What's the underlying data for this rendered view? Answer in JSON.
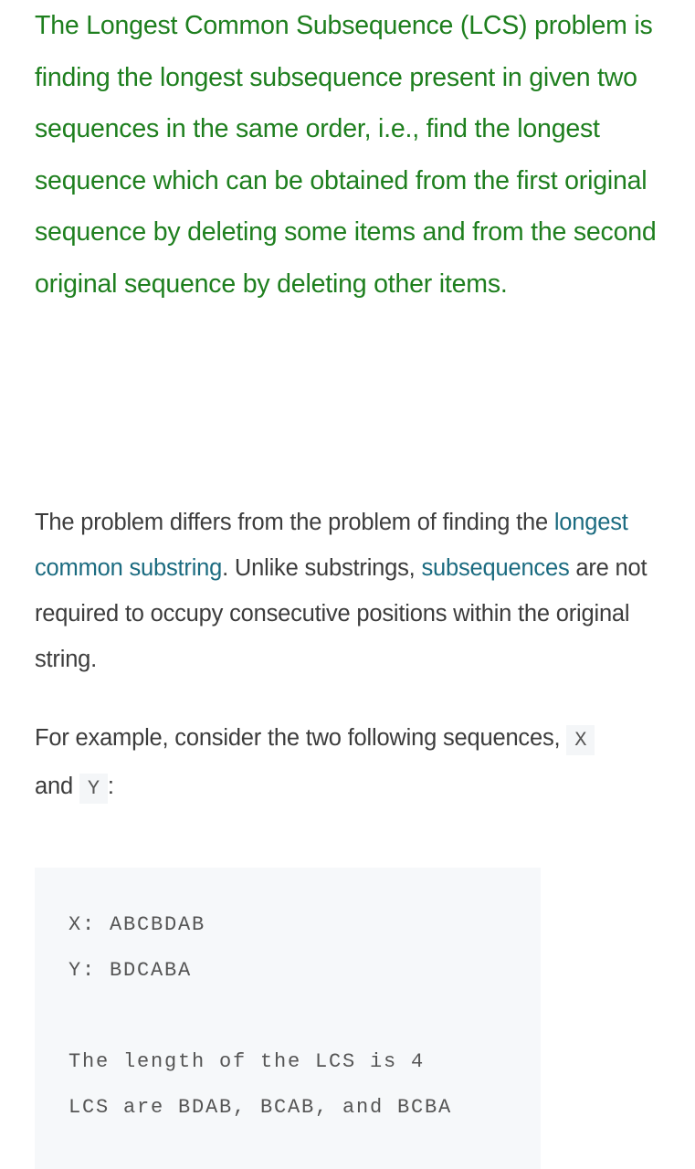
{
  "intro": {
    "text": "The Longest Common Subsequence (LCS) problem is finding the longest subsequence present in given two sequences in the same order, i.e., find the longest sequence which can be obtained from the first original sequence by deleting some items and from the second original sequence by deleting other items.",
    "color": "#1e7f1e"
  },
  "difference_paragraph": {
    "lead": "The problem differs from the problem of finding the ",
    "link_substring": "longest common substring",
    "middle": ". Unlike substrings, ",
    "link_subsequences": "subsequences",
    "tail": " are not required to occupy consecutive positions within the original string.",
    "link_color": "#1b6b80"
  },
  "example_paragraph": {
    "lead": "For example, consider the two following sequences, ",
    "code_x": "X",
    "connector": " and ",
    "code_y": "Y",
    "tail": ":"
  },
  "code_block": {
    "lines": [
      "X: ABCBDAB",
      "Y: BDCABA",
      "",
      "The length of the LCS is 4",
      "LCS are BDAB, BCAB, and BCBA"
    ]
  }
}
